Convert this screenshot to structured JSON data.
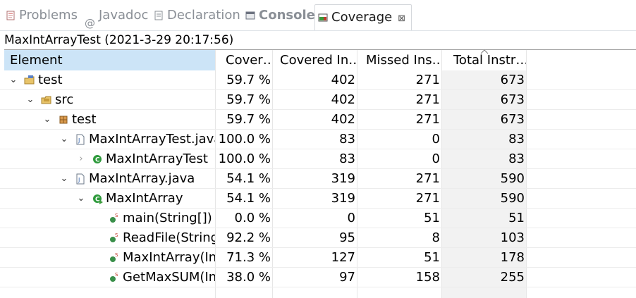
{
  "tabs": [
    {
      "label": "Problems",
      "icon": "problems-icon"
    },
    {
      "label": "Javadoc",
      "icon": "javadoc-icon"
    },
    {
      "label": "Declaration",
      "icon": "declaration-icon"
    },
    {
      "label": "Console",
      "icon": "console-icon"
    },
    {
      "label": "Coverage",
      "icon": "coverage-icon",
      "close": "⊠"
    }
  ],
  "session": "MaxIntArrayTest (2021-3-29 20:17:56)",
  "columns": [
    "Element",
    "Cover…",
    "Covered In…",
    "Missed Ins…",
    "Total Instr…"
  ],
  "rows": [
    {
      "name": "test",
      "icon": "project-folder-icon",
      "twisty": "expanded",
      "cov": "59.7 %",
      "covered": "402",
      "missed": "271",
      "total": "673"
    },
    {
      "name": "src",
      "icon": "source-folder-icon",
      "twisty": "expanded",
      "cov": "59.7 %",
      "covered": "402",
      "missed": "271",
      "total": "673"
    },
    {
      "name": "test",
      "icon": "package-icon",
      "twisty": "expanded",
      "cov": "59.7 %",
      "covered": "402",
      "missed": "271",
      "total": "673"
    },
    {
      "name": "MaxIntArrayTest.java",
      "icon": "java-file-icon",
      "twisty": "expanded",
      "cov": "100.0 %",
      "covered": "83",
      "missed": "0",
      "total": "83"
    },
    {
      "name": "MaxIntArrayTest",
      "icon": "class-icon",
      "twisty": "collapsed",
      "cov": "100.0 %",
      "covered": "83",
      "missed": "0",
      "total": "83"
    },
    {
      "name": "MaxIntArray.java",
      "icon": "java-file-icon",
      "twisty": "expanded",
      "cov": "54.1 %",
      "covered": "319",
      "missed": "271",
      "total": "590"
    },
    {
      "name": "MaxIntArray",
      "icon": "class-main-icon",
      "twisty": "expanded",
      "cov": "54.1 %",
      "covered": "319",
      "missed": "271",
      "total": "590"
    },
    {
      "name": "main(String[])",
      "icon": "static-method-icon",
      "twisty": "",
      "cov": "0.0 %",
      "covered": "0",
      "missed": "51",
      "total": "51"
    },
    {
      "name": "ReadFile(String",
      "icon": "static-method-icon",
      "twisty": "",
      "cov": "92.2 %",
      "covered": "95",
      "missed": "8",
      "total": "103"
    },
    {
      "name": "MaxIntArray(In",
      "icon": "static-method-icon",
      "twisty": "",
      "cov": "71.3 %",
      "covered": "127",
      "missed": "51",
      "total": "178"
    },
    {
      "name": "GetMaxSUM(In",
      "icon": "static-method-icon",
      "twisty": "",
      "cov": "38.0 %",
      "covered": "97",
      "missed": "158",
      "total": "255"
    }
  ],
  "colors": {
    "header_selected": "#cce4f7",
    "sorted_column": "#f2f2f2",
    "class_green": "#2e9a3c",
    "method_green": "#3a8f4a"
  }
}
